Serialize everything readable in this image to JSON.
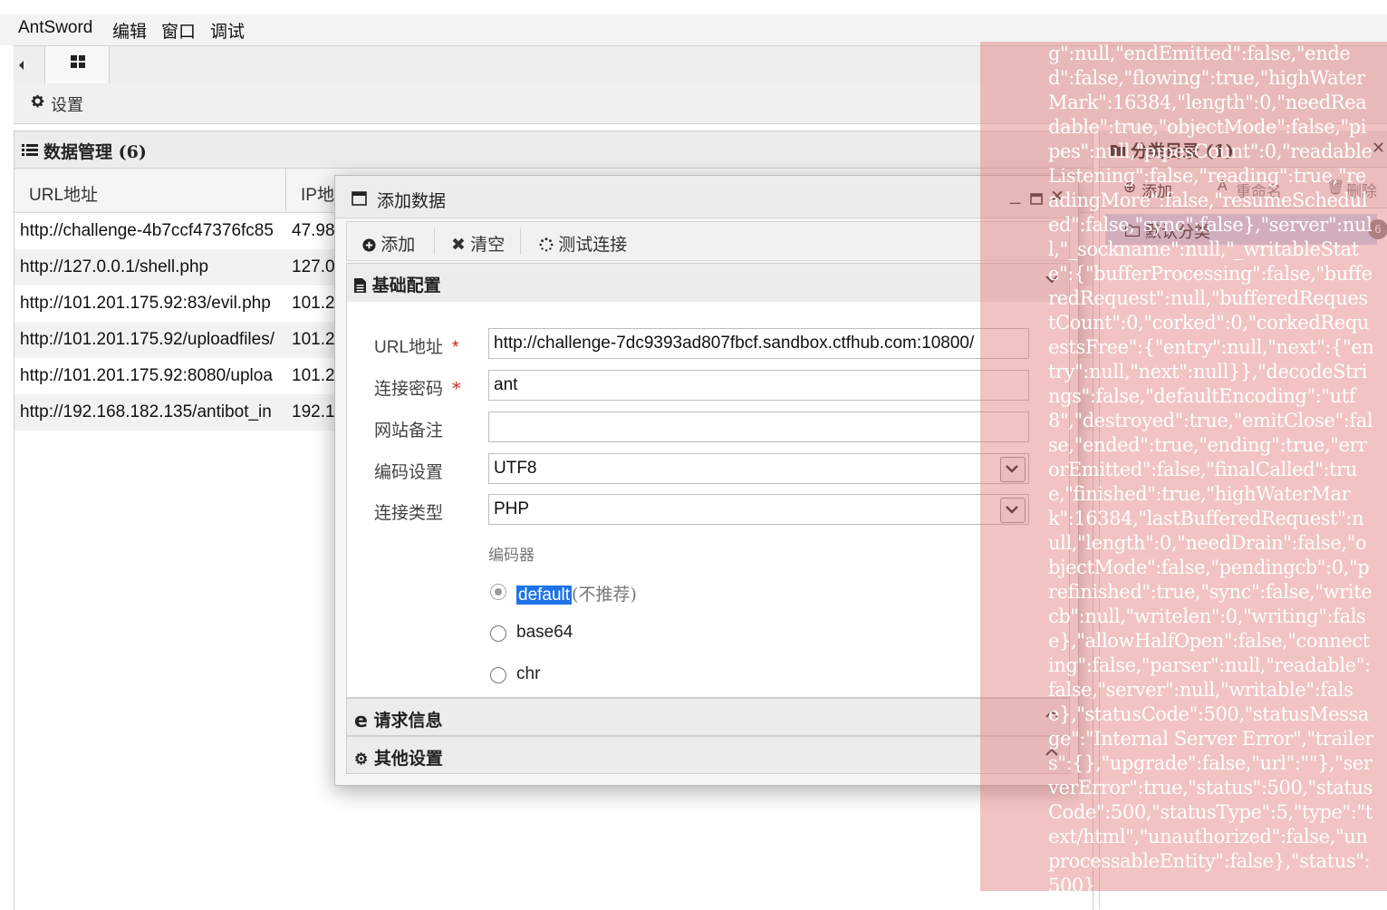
{
  "menu": {
    "items": [
      "AntSword",
      "编辑",
      "窗口",
      "调试"
    ]
  },
  "settings": {
    "label": "设置"
  },
  "data_panel": {
    "title": "数据管理 (6)",
    "columns": [
      "URL地址",
      "IP地"
    ],
    "rows": [
      {
        "url": "http://challenge-4b7ccf47376fc85",
        "ip": "47.98"
      },
      {
        "url": "http://127.0.0.1/shell.php",
        "ip": "127.0"
      },
      {
        "url": "http://101.201.175.92:83/evil.php",
        "ip": "101.2"
      },
      {
        "url": "http://101.201.175.92/uploadfiles/",
        "ip": "101.2"
      },
      {
        "url": "http://101.201.175.92:8080/uploa",
        "ip": "101.2"
      },
      {
        "url": "http://192.168.182.135/antibot_in",
        "ip": "192.1"
      }
    ]
  },
  "category_panel": {
    "title": "分类目录 (1)",
    "toolbar": {
      "add": "添加",
      "rename": "重命名",
      "delete": "删除"
    },
    "items": [
      {
        "label": "默认分类",
        "count": "6"
      }
    ]
  },
  "dialog": {
    "title": "添加数据",
    "toolbar": {
      "add": "添加",
      "clear": "清空",
      "test": "测试连接"
    },
    "sections": {
      "basic": "基础配置",
      "request": "请求信息",
      "other": "其他设置"
    },
    "form": {
      "url_label": "URL地址",
      "url_value": "http://challenge-7dc9393ad807fbcf.sandbox.ctfhub.com:10800/",
      "password_label": "连接密码",
      "password_value": "ant",
      "note_label": "网站备注",
      "note_value": "",
      "encoding_label": "编码设置",
      "encoding_value": "UTF8",
      "type_label": "连接类型",
      "type_value": "PHP",
      "encoder_label": "编码器",
      "required_mark": "*",
      "encoders": [
        {
          "label": "default",
          "note": "(不推荐)",
          "checked": true
        },
        {
          "label": "base64",
          "note": "",
          "checked": false
        },
        {
          "label": "chr",
          "note": "",
          "checked": false
        }
      ]
    }
  },
  "overlay": {
    "text": "g\":null,\"endEmitted\":false,\"ended\":false,\"flowing\":true,\"highWaterMark\":16384,\"length\":0,\"needReadable\":true,\"objectMode\":false,\"pipes\":null,\"pipesCount\":0,\"readableListening\":false,\"reading\":true,\"readingMore\":false,\"resumeScheduled\":false,\"sync\":false},\"server\":null,\"_sockname\":null,\"_writableState\":{\"bufferProcessing\":false,\"bufferedRequest\":null,\"bufferedRequestCount\":0,\"corked\":0,\"corkedRequestsFree\":{\"entry\":null,\"next\":{\"entry\":null,\"next\":null}},\"decodeStrings\":false,\"defaultEncoding\":\"utf8\",\"destroyed\":true,\"emitClose\":false,\"ended\":true,\"ending\":true,\"errorEmitted\":false,\"finalCalled\":true,\"finished\":true,\"highWaterMark\":16384,\"lastBufferedRequest\":null,\"length\":0,\"needDrain\":false,\"objectMode\":false,\"pendingcb\":0,\"prefinished\":true,\"sync\":false,\"writecb\":null,\"writelen\":0,\"writing\":false},\"allowHalfOpen\":false,\"connecting\":false,\"parser\":null,\"readable\":false,\"server\":null,\"writable\":false},\"statusCode\":500,\"statusMessage\":\"Internal Server Error\",\"trailers\":{},\"upgrade\":false,\"url\":\"\"},\"serverError\":true,\"status\":500,\"statusCode\":500,\"statusType\":5,\"type\":\"text/html\",\"unauthorized\":false,\"unprocessableEntity\":false},\"status\":500}"
  },
  "colors": {
    "accent": "#1e73e8",
    "overlay": "#e07070",
    "selection": "#c9dbf5"
  }
}
